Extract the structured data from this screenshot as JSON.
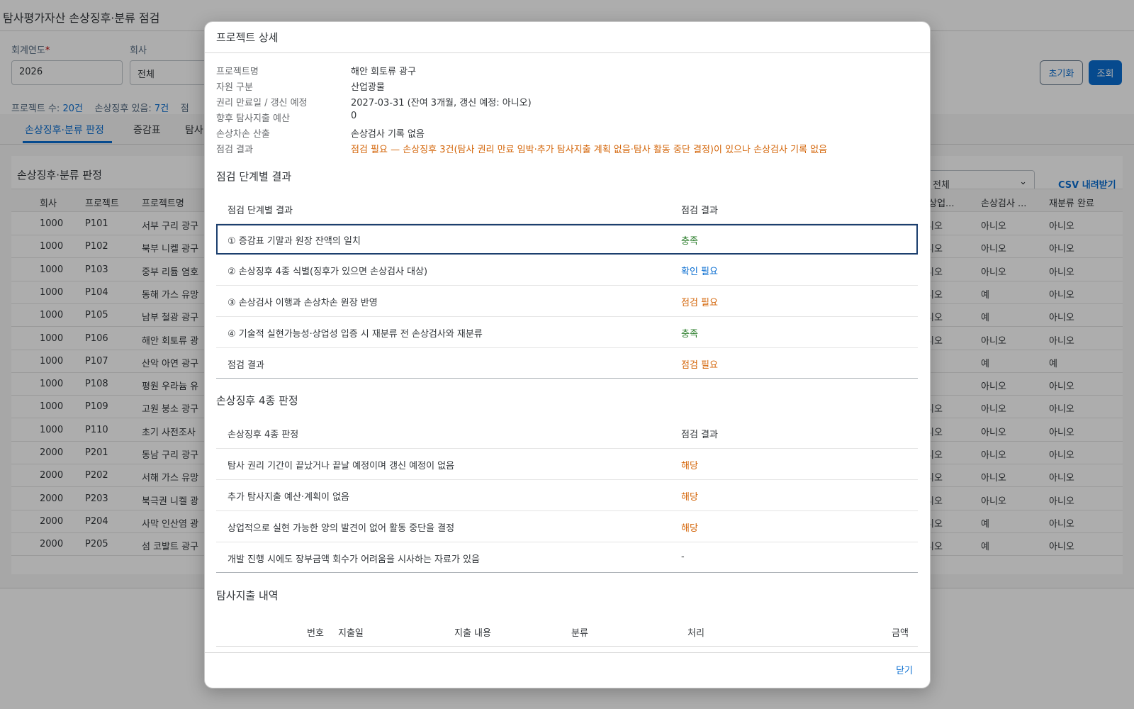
{
  "page": {
    "title": "탐사평가자산 손상징후·분류 점검",
    "filters": {
      "year_label": "회계연도",
      "year_required_mark": "*",
      "year_value": "2026",
      "company_label": "회사",
      "company_value": "전체"
    },
    "reset_label": "초기화",
    "query_label": "조회",
    "stats": {
      "project_count_label": "프로젝트 수:",
      "project_count": "20건",
      "impairment_label": "손상징후 있음:",
      "impairment_count": "7건",
      "partial": "점"
    },
    "tabs": [
      "손상징후·분류 판정",
      "증감표",
      "탐사"
    ],
    "table_title": "손상징후·분류 판정",
    "select_value": "전체",
    "csv_label": "CSV 내려받기",
    "columns": {
      "company": "회사",
      "project": "프로젝트",
      "project_name": "프로젝트명",
      "commercial": "·상업...",
      "impairment_test": "손상검사 ...",
      "reclass_done": "재분류 완료"
    },
    "rows": [
      {
        "company": "1000",
        "project": "P101",
        "name": "서부 구리 광구",
        "commercial": "니오",
        "test": "아니오",
        "reclass": "아니오"
      },
      {
        "company": "1000",
        "project": "P102",
        "name": "북부 니켈 광구",
        "commercial": "니오",
        "test": "아니오",
        "reclass": "아니오"
      },
      {
        "company": "1000",
        "project": "P103",
        "name": "중부 리튬 염호",
        "commercial": "니오",
        "test": "아니오",
        "reclass": "아니오"
      },
      {
        "company": "1000",
        "project": "P104",
        "name": "동해 가스 유망",
        "commercial": "니오",
        "test": "예",
        "reclass": "아니오"
      },
      {
        "company": "1000",
        "project": "P105",
        "name": "남부 철광 광구",
        "commercial": "니오",
        "test": "예",
        "reclass": "아니오"
      },
      {
        "company": "1000",
        "project": "P106",
        "name": "해안 회토류 광",
        "commercial": "니오",
        "test": "아니오",
        "reclass": "아니오"
      },
      {
        "company": "1000",
        "project": "P107",
        "name": "산악 아연 광구",
        "commercial": "",
        "test": "예",
        "reclass": "예"
      },
      {
        "company": "1000",
        "project": "P108",
        "name": "평원 우라늄 유",
        "commercial": "",
        "test": "아니오",
        "reclass": "아니오"
      },
      {
        "company": "1000",
        "project": "P109",
        "name": "고원 붕소 광구",
        "commercial": "니오",
        "test": "아니오",
        "reclass": "아니오"
      },
      {
        "company": "1000",
        "project": "P110",
        "name": "초기 사전조사",
        "commercial": "니오",
        "test": "아니오",
        "reclass": "아니오"
      },
      {
        "company": "2000",
        "project": "P201",
        "name": "동남 구리 광구",
        "commercial": "니오",
        "test": "아니오",
        "reclass": "아니오"
      },
      {
        "company": "2000",
        "project": "P202",
        "name": "서해 가스 유망",
        "commercial": "니오",
        "test": "아니오",
        "reclass": "아니오"
      },
      {
        "company": "2000",
        "project": "P203",
        "name": "북극권 니켈 광",
        "commercial": "니오",
        "test": "아니오",
        "reclass": "아니오"
      },
      {
        "company": "2000",
        "project": "P204",
        "name": "사막 인산염 광",
        "commercial": "니오",
        "test": "예",
        "reclass": "아니오"
      },
      {
        "company": "2000",
        "project": "P205",
        "name": "섬 코발트 광구",
        "commercial": "니오",
        "test": "예",
        "reclass": "아니오"
      }
    ]
  },
  "dialog": {
    "title": "프로젝트 상세",
    "info": [
      {
        "label": "프로젝트명",
        "value": "해안 회토류 광구",
        "status": "plain"
      },
      {
        "label": "자원 구분",
        "value": "산업광물",
        "status": "plain"
      },
      {
        "label": "권리 만료일 / 갱신 예정",
        "value": "2027-03-31 (잔여 3개월, 갱신 예정: 아니오)",
        "status": "plain"
      },
      {
        "label": "향후 탐사지출 예산",
        "value": "0",
        "status": "plain"
      },
      {
        "label": "손상차손 산출",
        "value": "손상검사 기록 없음",
        "status": "plain"
      },
      {
        "label": "점검 결과",
        "value": "점검 필요 — 손상징후 3건(탐사 권리 만료 임박·추가 탐사지출 계획 없음·탐사 활동 중단 결정)이 있으나 손상검사 기록 없음",
        "status": "warn"
      }
    ],
    "steps_title": "점검 단계별 결과",
    "steps_table": {
      "header_item": "점검 단계별 결과",
      "header_result": "점검 결과",
      "rows": [
        {
          "item": "① 증감표 기말과 원장 잔액의 일치",
          "result": "충족",
          "status": "ok"
        },
        {
          "item": "② 손상징후 4종 식별(징후가 있으면 손상검사 대상)",
          "result": "확인 필요",
          "status": "check"
        },
        {
          "item": "③ 손상검사 이행과 손상차손 원장 반영",
          "result": "점검 필요",
          "status": "warn"
        },
        {
          "item": "④ 기술적 실현가능성·상업성 입증 시 재분류 전 손상검사와 재분류",
          "result": "충족",
          "status": "ok"
        },
        {
          "item": "점검 결과",
          "result": "점검 필요",
          "status": "warn"
        }
      ]
    },
    "indicators_title": "손상징후 4종 판정",
    "indicators_table": {
      "header_item": "손상징후 4종 판정",
      "header_result": "점검 결과",
      "rows": [
        {
          "item": "탐사 권리 기간이 끝났거나 끝날 예정이며 갱신 예정이 없음",
          "result": "해당",
          "status": "warn"
        },
        {
          "item": "추가 탐사지출 예산·계획이 없음",
          "result": "해당",
          "status": "warn"
        },
        {
          "item": "상업적으로 실현 가능한 양의 발견이 없어 활동 중단을 결정",
          "result": "해당",
          "status": "warn"
        },
        {
          "item": "개발 진행 시에도 장부금액 회수가 어려움을 시사하는 자료가 있음",
          "result": "-",
          "status": "plain"
        }
      ]
    },
    "expenditure_title": "탐사지출 내역",
    "expenditure_columns": {
      "no": "번호",
      "date": "지출일",
      "desc": "지출 내용",
      "category": "분류",
      "process": "처리",
      "amount": "금액"
    },
    "close_label": "닫기"
  },
  "colors": {
    "accent": "#0a6ed1",
    "ok": "#2b7d2b",
    "warn": "#d4660a",
    "focus_outline": "#1c3f6e"
  }
}
